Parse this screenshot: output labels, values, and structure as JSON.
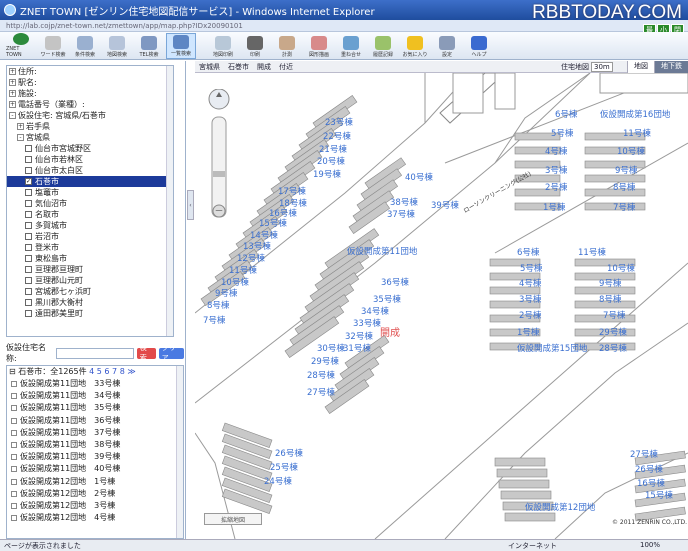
{
  "window": {
    "title": "ZNET TOWN [ゼンリン住宅地図配信サービス] - Windows Internet Explorer",
    "watermark": "RBBTODAY.COM",
    "address": "http://lab.cojp/znet-town.net/zmettown/app/map.php?IDx20090101"
  },
  "window_controls": [
    "最",
    "小",
    "閉"
  ],
  "toolbar": {
    "logo_label": "ZNET TOWN",
    "buttons": [
      {
        "label": "ZNET TOWN",
        "color": "#2c8a3c"
      },
      {
        "label": "ワード検索",
        "color": "#c4c4c4"
      },
      {
        "label": "条件検索",
        "color": "#9ab0d0"
      },
      {
        "label": "地図検索",
        "color": "#b6c4da"
      },
      {
        "label": "TEL検索",
        "color": "#7f98c2"
      },
      {
        "label": "一覧検索",
        "color": "#5d86c4"
      },
      {
        "label": "地図印刷",
        "color": "#b8c8d8"
      },
      {
        "label": "印刷",
        "color": "#666"
      },
      {
        "label": "計測",
        "color": "#c8a88a"
      },
      {
        "label": "図形描画",
        "color": "#d88a8a"
      },
      {
        "label": "重ね合せ",
        "color": "#6aa0d0"
      },
      {
        "label": "履歴記録",
        "color": "#9ac26a"
      },
      {
        "label": "お気に入り",
        "color": "#f0c020"
      },
      {
        "label": "設定",
        "color": "#8a9bb8"
      },
      {
        "label": "ヘルプ",
        "color": "#3a6ad0"
      }
    ]
  },
  "tree": {
    "items": [
      {
        "level": 0,
        "pm": "+",
        "text": "住所:"
      },
      {
        "level": 0,
        "pm": "+",
        "text": "駅名:"
      },
      {
        "level": 0,
        "pm": "+",
        "text": "施設:"
      },
      {
        "level": 0,
        "pm": "+",
        "text": "電話番号（業種）:"
      },
      {
        "level": 0,
        "pm": "-",
        "text": "仮設住宅:  宮城県/石巻市"
      },
      {
        "level": 1,
        "pm": "+",
        "text": "岩手県"
      },
      {
        "level": 1,
        "pm": "-",
        "text": "宮城県"
      },
      {
        "level": 2,
        "cb": " ",
        "text": "仙台市宮城野区"
      },
      {
        "level": 2,
        "cb": " ",
        "text": "仙台市若林区"
      },
      {
        "level": 2,
        "cb": " ",
        "text": "仙台市太白区"
      },
      {
        "level": 2,
        "cb": "✓",
        "text": "石巻市",
        "selected": true
      },
      {
        "level": 2,
        "cb": " ",
        "text": "塩竈市"
      },
      {
        "level": 2,
        "cb": " ",
        "text": "気仙沼市"
      },
      {
        "level": 2,
        "cb": " ",
        "text": "名取市"
      },
      {
        "level": 2,
        "cb": " ",
        "text": "多賀城市"
      },
      {
        "level": 2,
        "cb": " ",
        "text": "岩沼市"
      },
      {
        "level": 2,
        "cb": " ",
        "text": "登米市"
      },
      {
        "level": 2,
        "cb": " ",
        "text": "東松島市"
      },
      {
        "level": 2,
        "cb": " ",
        "text": "亘理郡亘理町"
      },
      {
        "level": 2,
        "cb": " ",
        "text": "亘理郡山元町"
      },
      {
        "level": 2,
        "cb": " ",
        "text": "宮城郡七ヶ浜町"
      },
      {
        "level": 2,
        "cb": " ",
        "text": "黒川郡大衡村"
      },
      {
        "level": 2,
        "cb": " ",
        "text": "遠田郡美里町"
      }
    ]
  },
  "search": {
    "label": "仮設住宅名称:",
    "value": "",
    "search_button": "検索",
    "clear_button": "クリア",
    "search_color": "#e24a4a",
    "clear_color": "#4a7ae2"
  },
  "results": {
    "header_prefix": "石巻市：全1265件",
    "pages": "4 5 6 7 8 ≫",
    "items": [
      "仮設開成第11団地　33号棟",
      "仮設開成第11団地　34号棟",
      "仮設開成第11団地　35号棟",
      "仮設開成第11団地　36号棟",
      "仮設開成第11団地　37号棟",
      "仮設開成第11団地　38号棟",
      "仮設開成第11団地　39号棟",
      "仮設開成第11団地　40号棟",
      "仮設開成第12団地　1号棟",
      "仮設開成第12団地　2号棟",
      "仮設開成第12団地　3号棟",
      "仮設開成第12団地　4号棟"
    ]
  },
  "map": {
    "header_left": [
      "宮城県",
      "石巻市",
      "開成",
      "付近"
    ],
    "scale_label": "住宅地図",
    "scale_value": "30m",
    "tab_map": "地図",
    "tab_aerial": "地下鉄",
    "area_label": "開成",
    "area_color": "#e05050",
    "label_color": "#3a6fd0",
    "block_fill": "#c8c8c8",
    "road_label": "ローソンクリーニング(公社)",
    "minimap_button": "拡縮地図",
    "copyright": "© 2011 ZENRIN CO.,LTD.",
    "labels": [
      {
        "t": "23号棟"
      },
      {
        "t": "22号棟"
      },
      {
        "t": "21号棟"
      },
      {
        "t": "20号棟"
      },
      {
        "t": "19号棟"
      },
      {
        "t": "18号棟"
      },
      {
        "t": "17号棟"
      },
      {
        "t": "16号棟"
      },
      {
        "t": "15号棟"
      },
      {
        "t": "14号棟"
      },
      {
        "t": "13号棟"
      },
      {
        "t": "12号棟"
      },
      {
        "t": "11号棟"
      },
      {
        "t": "10号棟"
      },
      {
        "t": "9号棟"
      },
      {
        "t": "8号棟"
      },
      {
        "t": "7号棟"
      },
      {
        "t": "40号棟"
      },
      {
        "t": "38号棟"
      },
      {
        "t": "39号棟"
      },
      {
        "t": "37号棟"
      },
      {
        "t": "仮設開成第11団地"
      },
      {
        "t": "36号棟"
      },
      {
        "t": "35号棟"
      },
      {
        "t": "34号棟"
      },
      {
        "t": "33号棟"
      },
      {
        "t": "32号棟"
      },
      {
        "t": "30号棟"
      },
      {
        "t": "31号棟"
      },
      {
        "t": "29号棟"
      },
      {
        "t": "28号棟"
      },
      {
        "t": "27号棟"
      },
      {
        "t": "26号棟"
      },
      {
        "t": "25号棟"
      },
      {
        "t": "24号棟"
      },
      {
        "t": "仮設開成第12団地"
      },
      {
        "t": "6号棟"
      },
      {
        "t": "5号棟"
      },
      {
        "t": "4号棟"
      },
      {
        "t": "3号棟"
      },
      {
        "t": "2号棟"
      },
      {
        "t": "1号棟"
      },
      {
        "t": "仮設開成第16団地"
      },
      {
        "t": "11号棟"
      },
      {
        "t": "10号棟"
      },
      {
        "t": "9号棟"
      },
      {
        "t": "8号棟"
      },
      {
        "t": "7号棟"
      },
      {
        "t": "6号棟"
      },
      {
        "t": "5号棟"
      },
      {
        "t": "4号棟"
      },
      {
        "t": "3号棟"
      },
      {
        "t": "2号棟"
      },
      {
        "t": "1号棟"
      },
      {
        "t": "仮設開成第15団地"
      },
      {
        "t": "11号棟"
      },
      {
        "t": "10号棟"
      },
      {
        "t": "9号棟"
      },
      {
        "t": "8号棟"
      },
      {
        "t": "7号棟"
      },
      {
        "t": "29号棟"
      },
      {
        "t": "28号棟"
      },
      {
        "t": "27号棟"
      },
      {
        "t": "26号棟"
      },
      {
        "t": "16号棟"
      },
      {
        "t": "15号棟"
      }
    ]
  },
  "status": {
    "left": "ページが表示されました",
    "zone": "インターネット",
    "zoom": "100%"
  }
}
